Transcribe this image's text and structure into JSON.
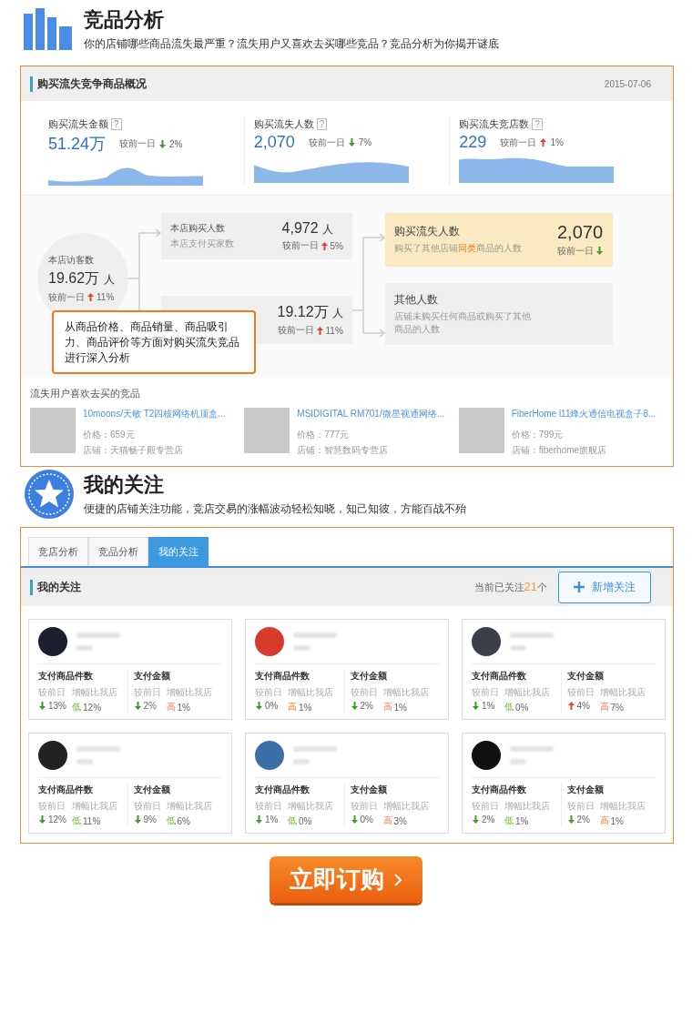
{
  "header1": {
    "title": "竞品分析",
    "subtitle": "你的店铺哪些商品流失最严重？流失用户又喜欢去买哪些竞品？竞品分析为你揭开谜底"
  },
  "overview": {
    "title": "购买流失竞争商品概况",
    "date": "2015-07-06",
    "metrics": [
      {
        "label": "购买流失金额",
        "help": "?",
        "value": "51.24万",
        "compare": "较前一日",
        "rising": false,
        "change": "2%"
      },
      {
        "label": "购买流失人数",
        "help": "?",
        "value": "2,070",
        "compare": "较前一日",
        "rising": false,
        "change": "7%"
      },
      {
        "label": "购买流失竞店数",
        "help": "?",
        "value": "229",
        "compare": "较前一日",
        "rising": true,
        "change": "1%"
      }
    ],
    "flow": {
      "visitors": {
        "label": "本店访客数",
        "value": "19.62万",
        "unit": "人",
        "compare": "较前一日",
        "rising": true,
        "change": "11%"
      },
      "buyers": {
        "label": "本店购买人数",
        "desc": "本店支付买家数",
        "value": "4,972",
        "unit": "人",
        "compare": "较前一日",
        "rising": true,
        "change": "5%"
      },
      "non_buyers": {
        "value": "19.12万",
        "unit": "人",
        "compare": "较前一日",
        "rising": true,
        "change": "11%"
      },
      "lost": {
        "label": "购买流失人数",
        "desc": "购买了其他店铺**同类**商品的人数",
        "value": "2,070",
        "compare": "较前一日",
        "rising": false,
        "highlighted": true
      },
      "other": {
        "label": "其他人数",
        "desc": "店铺未购买任何商品或购买了其他商品的人数",
        "highlighted": false
      }
    },
    "callout": "从商品价格、商品销量、商品吸引力、商品评价等方面对购买流失竞品进行深入分析",
    "competitors": {
      "title": "流失用户喜欢去买的竞品",
      "items": [
        {
          "name": "10moons/天敏 T2四核网络机顶盒...",
          "price": "价格：659元",
          "shop": "店铺：天猫畅子殿专营店"
        },
        {
          "name": "MSIDIGITAL RM701/微星视通网络...",
          "price": "价格：777元",
          "shop": "店铺：智慧数码专营店"
        },
        {
          "name": "FiberHome i11烽火通信电视盒子8...",
          "price": "价格：799元",
          "shop": "店铺：fiberhome旗舰店"
        }
      ]
    }
  },
  "header2": {
    "title": "我的关注",
    "subtitle": "便捷的店铺关注功能，竞店交易的涨幅波动轻松知晓，知己知彼，方能百战不殆"
  },
  "follow": {
    "tabs": [
      {
        "label": "竞店分析",
        "selected": false
      },
      {
        "label": "竞品分析",
        "selected": false
      },
      {
        "label": "我的关注",
        "selected": true
      }
    ],
    "title": "我的关注",
    "count_prefix": "当前已关注",
    "count": "21",
    "count_suffix": "个",
    "add_button": "新增关注",
    "cards": [
      {
        "color": "#1c1f2e",
        "groups": [
          {
            "title": "支付商品件数",
            "cols": [
              {
                "label": "较前日",
                "rising": false,
                "value": "13%"
              },
              {
                "label": "增幅比我店",
                "tag": "低",
                "higher": false,
                "value": "12%"
              }
            ]
          },
          {
            "title": "支付金额",
            "cols": [
              {
                "label": "较前日",
                "rising": false,
                "value": "2%"
              },
              {
                "label": "增幅比我店",
                "tag": "高",
                "higher": true,
                "value": "1%"
              }
            ]
          }
        ]
      },
      {
        "color": "#d63b2c",
        "groups": [
          {
            "title": "支付商品件数",
            "cols": [
              {
                "label": "较前日",
                "rising": false,
                "value": "0%"
              },
              {
                "label": "增幅比我店",
                "tag": "高",
                "higher": true,
                "value": "1%"
              }
            ]
          },
          {
            "title": "支付金额",
            "cols": [
              {
                "label": "较前日",
                "rising": false,
                "value": "2%"
              },
              {
                "label": "增幅比我店",
                "tag": "高",
                "higher": true,
                "value": "1%"
              }
            ]
          }
        ]
      },
      {
        "color": "#3a3f4a",
        "groups": [
          {
            "title": "支付商品件数",
            "cols": [
              {
                "label": "较前日",
                "rising": false,
                "value": "1%"
              },
              {
                "label": "增幅比我店",
                "tag": "低",
                "higher": false,
                "value": "0%"
              }
            ]
          },
          {
            "title": "支付金额",
            "cols": [
              {
                "label": "较前日",
                "rising": true,
                "value": "4%"
              },
              {
                "label": "增幅比我店",
                "tag": "高",
                "higher": true,
                "value": "7%"
              }
            ]
          }
        ]
      },
      {
        "color": "#222222",
        "groups": [
          {
            "title": "支付商品件数",
            "cols": [
              {
                "label": "较前日",
                "rising": false,
                "value": "12%"
              },
              {
                "label": "增幅比我店",
                "tag": "低",
                "higher": false,
                "value": "11%"
              }
            ]
          },
          {
            "title": "支付金额",
            "cols": [
              {
                "label": "较前日",
                "rising": false,
                "value": "9%"
              },
              {
                "label": "增幅比我店",
                "tag": "低",
                "higher": false,
                "value": "6%"
              }
            ]
          }
        ]
      },
      {
        "color": "#3b6ea5",
        "groups": [
          {
            "title": "支付商品件数",
            "cols": [
              {
                "label": "较前日",
                "rising": false,
                "value": "1%"
              },
              {
                "label": "增幅比我店",
                "tag": "低",
                "higher": false,
                "value": "0%"
              }
            ]
          },
          {
            "title": "支付金额",
            "cols": [
              {
                "label": "较前日",
                "rising": false,
                "value": "0%"
              },
              {
                "label": "增幅比我店",
                "tag": "高",
                "higher": true,
                "value": "3%"
              }
            ]
          }
        ]
      },
      {
        "color": "#111111",
        "groups": [
          {
            "title": "支付商品件数",
            "cols": [
              {
                "label": "较前日",
                "rising": false,
                "value": "2%"
              },
              {
                "label": "增幅比我店",
                "tag": "低",
                "higher": false,
                "value": "1%"
              }
            ]
          },
          {
            "title": "支付金额",
            "cols": [
              {
                "label": "较前日",
                "rising": false,
                "value": "2%"
              },
              {
                "label": "增幅比我店",
                "tag": "高",
                "higher": true,
                "value": "1%"
              }
            ]
          }
        ]
      }
    ]
  },
  "order_button": "立即订购"
}
